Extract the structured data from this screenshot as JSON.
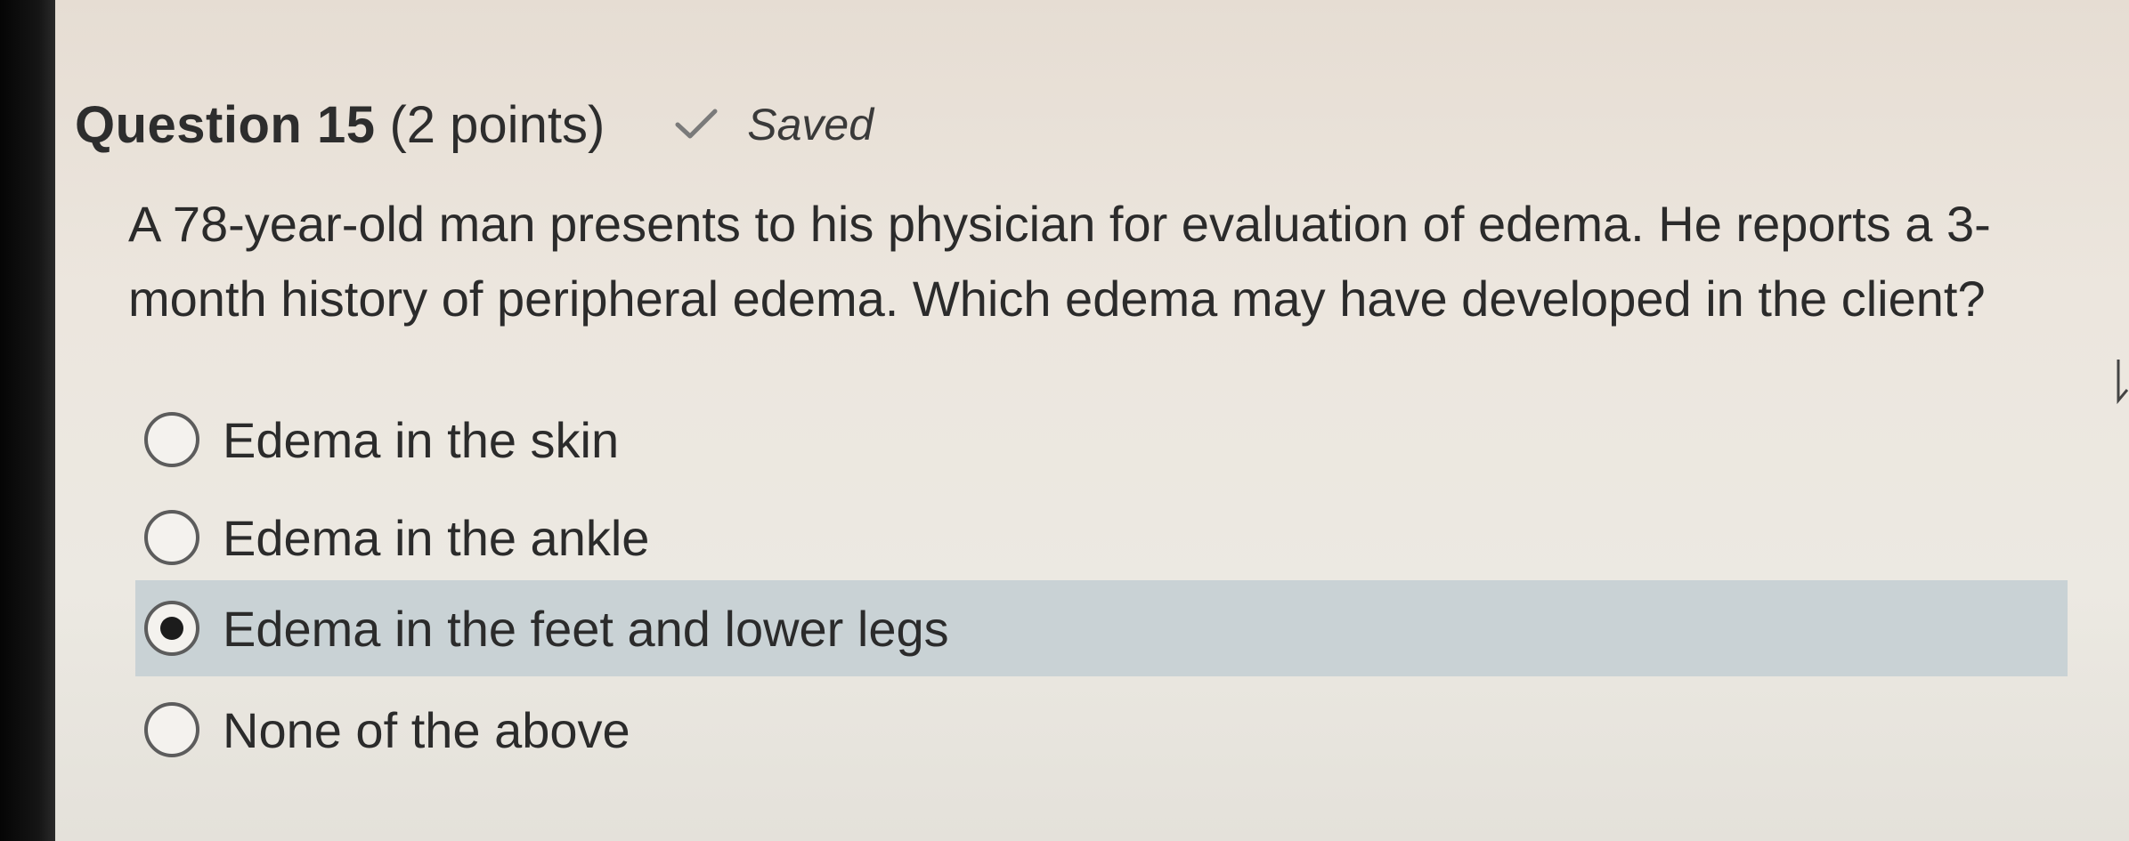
{
  "question": {
    "title": "Question 15",
    "points": "(2 points)",
    "status_icon": "check-icon",
    "status_label": "Saved",
    "text": "A 78-year-old man presents to his physician for evaluation of edema. He reports a 3-month history of peripheral edema. Which edema may have developed in the client?"
  },
  "options": [
    {
      "label": "Edema in the skin",
      "selected": false
    },
    {
      "label": "Edema in the ankle",
      "selected": false
    },
    {
      "label": "Edema in the feet and lower legs",
      "selected": true
    },
    {
      "label": "None of the above",
      "selected": false
    }
  ],
  "colors": {
    "selected_row": "#c9d2d5",
    "text": "#2b2b2b"
  }
}
